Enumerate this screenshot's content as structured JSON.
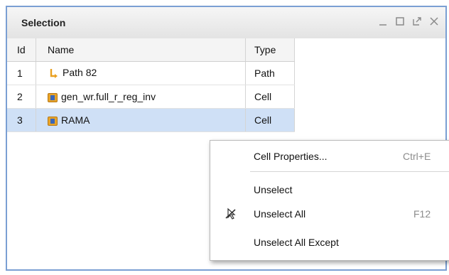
{
  "panel": {
    "title": "Selection",
    "window_buttons": [
      "minimize-icon",
      "maximize-icon",
      "float-icon",
      "close-icon"
    ]
  },
  "table": {
    "columns": [
      "Id",
      "Name",
      "Type"
    ],
    "rows": [
      {
        "id": "1",
        "name": "Path 82",
        "type": "Path",
        "icon": "path-icon"
      },
      {
        "id": "2",
        "name": "gen_wr.full_r_reg_inv",
        "type": "Cell",
        "icon": "cell-icon"
      },
      {
        "id": "3",
        "name": "RAMA",
        "type": "Cell",
        "icon": "cell-icon",
        "selected": true
      }
    ]
  },
  "context_menu": {
    "items": [
      {
        "label": "Cell Properties...",
        "shortcut": "Ctrl+E"
      },
      {
        "label": "Unselect",
        "shortcut": ""
      },
      {
        "label": "Unselect All",
        "shortcut": "F12",
        "icon": "unselect-all-icon"
      },
      {
        "label": "Unselect All Except",
        "shortcut": ""
      }
    ]
  },
  "colors": {
    "panel_border": "#7a9fd3",
    "selected_row": "#cfe0f6",
    "cell_icon": "#e7a42a",
    "path_icon": "#e9a020"
  }
}
